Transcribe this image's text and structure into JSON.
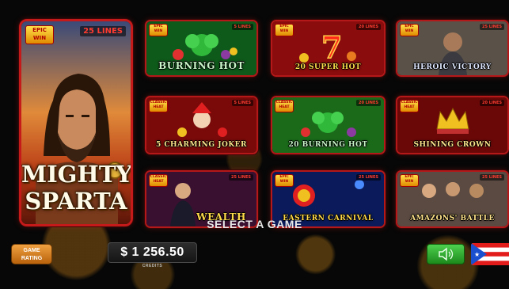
{
  "featured_game": {
    "badge": "EPIC WIN",
    "lines": "25 LINES",
    "title_line1": "MIGHTY",
    "title_line2": "SPARTA"
  },
  "games": [
    {
      "badge": "EPIC WIN",
      "lines": "5 LINES",
      "title": "BURNING HOT"
    },
    {
      "badge": "EPIC WIN",
      "lines": "20 LINES",
      "title": "20 SUPER HOT"
    },
    {
      "badge": "EPIC WIN",
      "lines": "25 LINES",
      "title": "HEROIC VICTORY"
    },
    {
      "badge": "CLASSIC HEAT",
      "lines": "5 LINES",
      "title": "5 CHARMING JOKER"
    },
    {
      "badge": "CLASSIC HEAT",
      "lines": "20 LINES",
      "title": "20 BURNING HOT"
    },
    {
      "badge": "CLASSIC HEAT",
      "lines": "20 LINES",
      "title": "SHINING CROWN"
    },
    {
      "badge": "CLASSIC HEAT",
      "lines": "25 LINES",
      "title": "WEALTH"
    },
    {
      "badge": "EPIC WIN",
      "lines": "25 LINES",
      "title": "EASTERN CARNIVAL"
    },
    {
      "badge": "EPIC WIN",
      "lines": "25 LINES",
      "title": "AMAZONS' BATTLE"
    }
  ],
  "select_label": "SELECT A GAME",
  "rating_button": {
    "line1": "GAME",
    "line2": "RATING"
  },
  "credits": {
    "value": "$ 1 256.50",
    "label": "CREDITS"
  },
  "icons": {
    "sound": "speaker-icon",
    "language": "puerto-rico-flag-icon"
  },
  "colors": {
    "card_border": "#b41818",
    "sound_button": "#2fb02f",
    "rating_button": "#d9801f"
  }
}
